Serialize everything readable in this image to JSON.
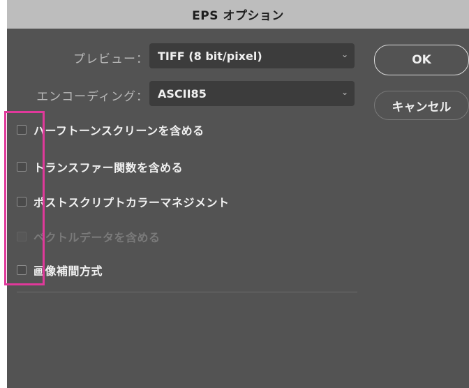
{
  "window": {
    "title": "EPS オプション"
  },
  "preview": {
    "label": "プレビュー：",
    "value": "TIFF (8 bit/pixel)"
  },
  "encoding": {
    "label": "エンコーディング：",
    "value": "ASCII85"
  },
  "buttons": {
    "ok": "OK",
    "cancel": "キャンセル"
  },
  "options": [
    {
      "label": "ハーフトーンスクリーンを含める",
      "checked": false,
      "enabled": true
    },
    {
      "label": "トランスファー関数を含める",
      "checked": false,
      "enabled": true
    },
    {
      "label": "ポストスクリプトカラーマネジメント",
      "checked": false,
      "enabled": true
    },
    {
      "label": "ベクトルデータを含める",
      "checked": false,
      "enabled": false
    },
    {
      "label": "画像補間方式",
      "checked": false,
      "enabled": true
    }
  ],
  "colors": {
    "highlight": "#e0399b",
    "dialog_bg": "#535353",
    "titlebar_bg": "#bdbdbd"
  }
}
